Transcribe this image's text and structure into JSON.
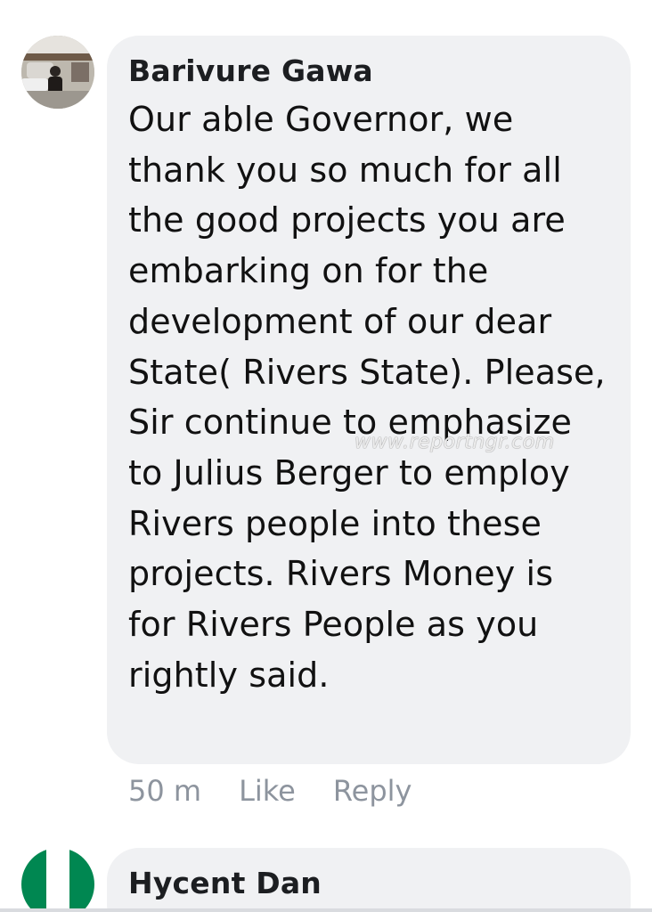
{
  "comments": [
    {
      "author": "Barivure Gawa",
      "text": "Our able Governor, we thank you so much for all the good projects you are embarking on for the development of our dear State( Rivers State). Please, Sir continue to emphasize to Julius Berger to employ Rivers people into these projects. Rivers Money is for Rivers People as you rightly said.",
      "time": "50 m",
      "like_label": "Like",
      "reply_label": "Reply"
    },
    {
      "author": "Hycent Dan"
    }
  ],
  "watermark": "www.reportngr.com",
  "colors": {
    "bubble": "#f0f1f3",
    "meta_text": "#8d949e",
    "flag_green": "#008751"
  }
}
